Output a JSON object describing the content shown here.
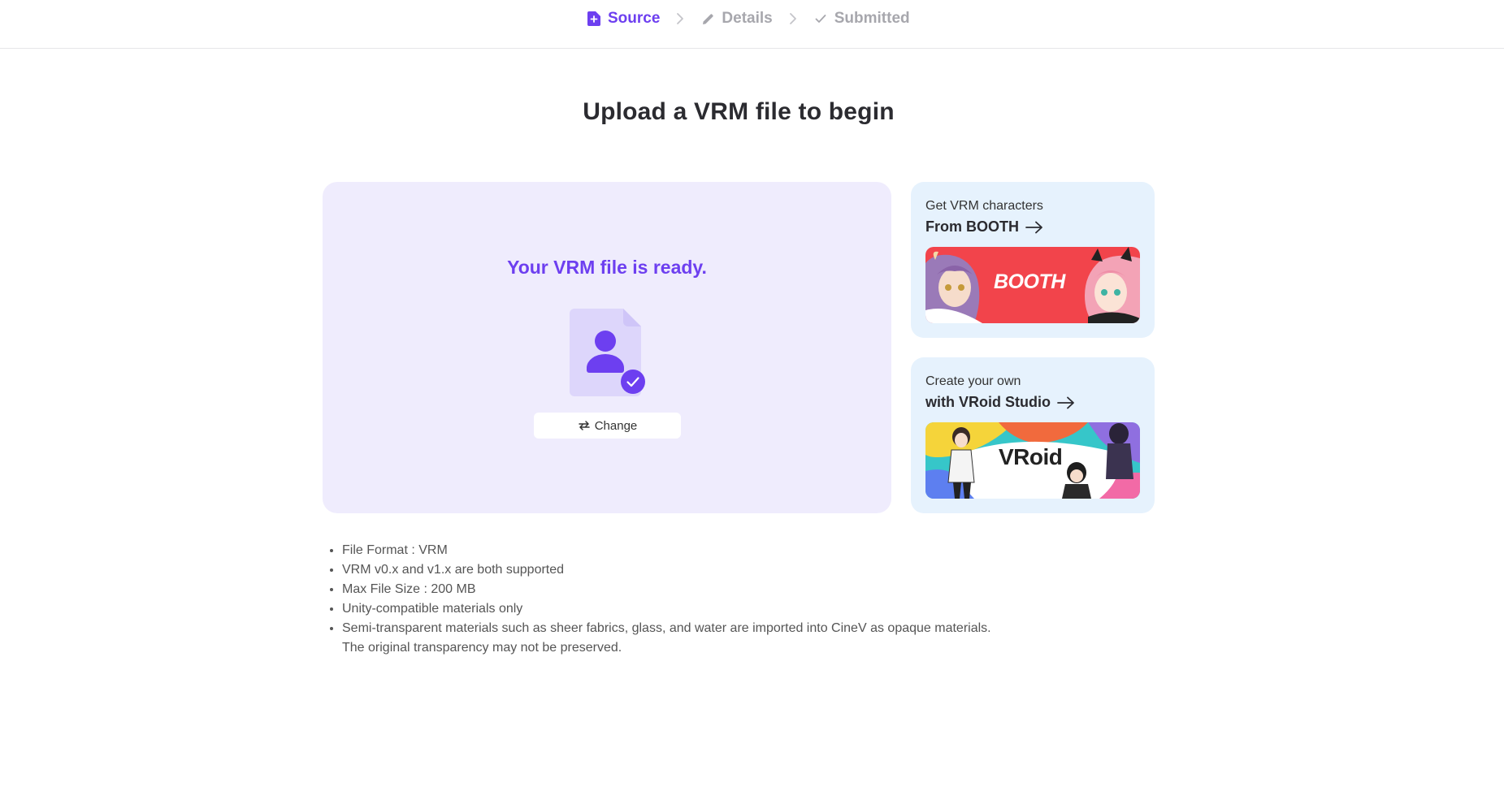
{
  "stepper": {
    "steps": [
      {
        "label": "Source",
        "icon": "file-plus-icon",
        "state": "active"
      },
      {
        "label": "Details",
        "icon": "pencil-icon",
        "state": "inactive"
      },
      {
        "label": "Submitted",
        "icon": "check-icon",
        "state": "inactive"
      }
    ],
    "separator_icon": "chevron-right-icon"
  },
  "page": {
    "title": "Upload a VRM file to begin"
  },
  "upload": {
    "status_text": "Your VRM file is ready.",
    "file_icon": "vrm-file-user-icon",
    "check_badge_icon": "check-circle-icon",
    "change_button_label": "Change",
    "change_button_icon": "swap-arrows-icon"
  },
  "promos": {
    "booth": {
      "subtitle": "Get VRM characters",
      "link_label": "From BOOTH",
      "banner_text": "BOOTH",
      "banner_color": "#f2444b"
    },
    "vroid": {
      "subtitle": "Create your own",
      "link_label": "with VRoid Studio",
      "banner_text": "VRoid"
    }
  },
  "requirements": [
    "File Format : VRM",
    "VRM v0.x and v1.x are both supported",
    "Max File Size : 200 MB",
    "Unity-compatible materials only",
    "Semi-transparent materials such as sheer fabrics, glass, and water are imported into CineV as opaque materials."
  ],
  "requirements_note": "The original transparency may not be preserved.",
  "colors": {
    "accent": "#6d3ff0",
    "upload_card_bg": "#efecfd",
    "promo_card_bg": "#e6f2fd",
    "inactive_step": "#a7a7ad"
  }
}
